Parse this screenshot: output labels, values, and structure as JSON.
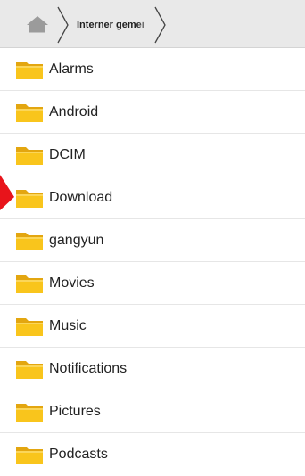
{
  "breadcrumb": {
    "home_icon": "home-icon",
    "current": "Interner gemei"
  },
  "folders": [
    {
      "name": "Alarms"
    },
    {
      "name": "Android"
    },
    {
      "name": "DCIM"
    },
    {
      "name": "Download"
    },
    {
      "name": "gangyun"
    },
    {
      "name": "Movies"
    },
    {
      "name": "Music"
    },
    {
      "name": "Notifications"
    },
    {
      "name": "Pictures"
    },
    {
      "name": "Podcasts"
    }
  ],
  "colors": {
    "folder_fill": "#f9c51c",
    "folder_tab": "#e3a610",
    "annotation_arrow": "#e8141b"
  }
}
